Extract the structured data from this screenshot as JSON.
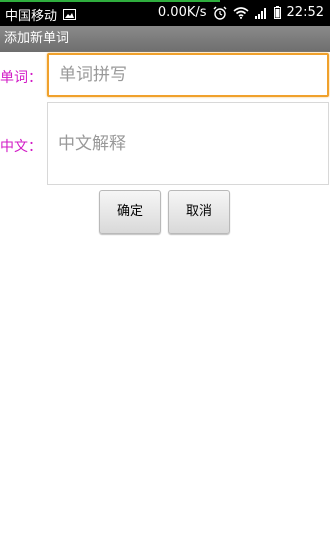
{
  "status_bar": {
    "carrier": "中国移动",
    "image_icon": "image-icon",
    "network_speed": "0.00K/s",
    "alarm_icon": "alarm-icon",
    "wifi_icon": "wifi-icon",
    "signal_icon": "signal-icon",
    "battery_icon": "battery-icon",
    "time": "22:52",
    "progress_color": "#2fae3e"
  },
  "title_bar": {
    "title": "添加新单词"
  },
  "form": {
    "word_label": "单词：",
    "word_placeholder": "单词拼写",
    "chinese_label": "中文：",
    "chinese_placeholder": "中文解释",
    "label_color": "#d21bc6",
    "focus_color": "#f0a12b"
  },
  "buttons": {
    "ok_label": "确定",
    "cancel_label": "取消"
  }
}
